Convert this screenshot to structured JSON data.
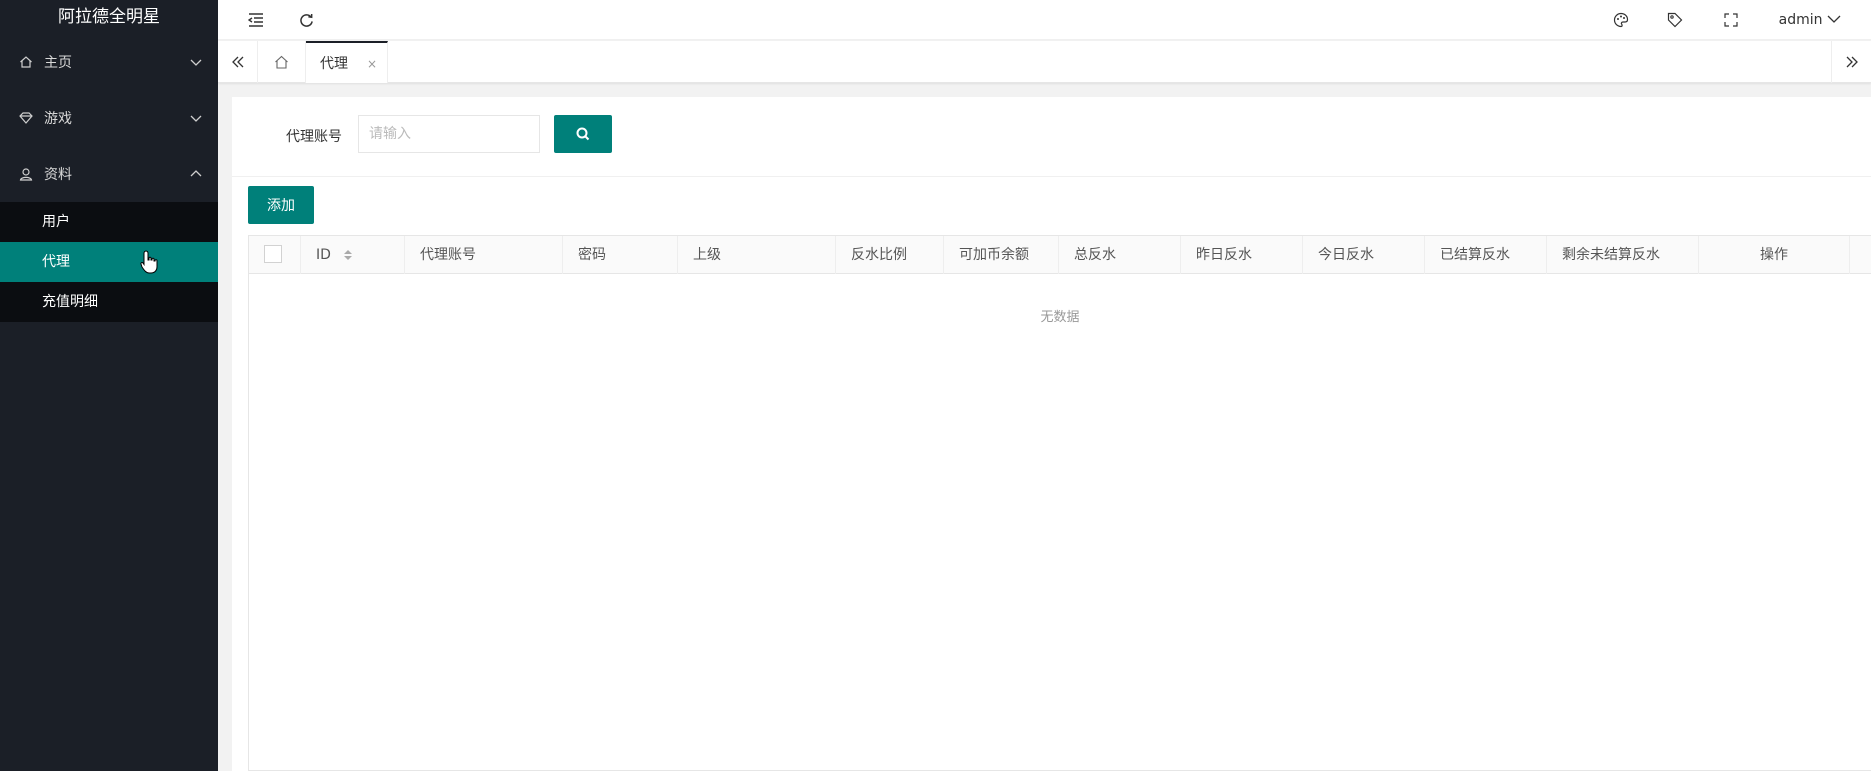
{
  "app": {
    "title": "阿拉德全明星"
  },
  "sidebar": {
    "items": [
      {
        "label": "主页",
        "icon": "home-icon",
        "expanded": false
      },
      {
        "label": "游戏",
        "icon": "diamond-icon",
        "expanded": false
      },
      {
        "label": "资料",
        "icon": "user-icon",
        "expanded": true
      }
    ],
    "subitems": [
      {
        "label": "用户",
        "active": false
      },
      {
        "label": "代理",
        "active": true
      },
      {
        "label": "充值明细",
        "active": false
      }
    ]
  },
  "header": {
    "user": "admin"
  },
  "tabs": {
    "active_label": "代理",
    "close": "×"
  },
  "search": {
    "label": "代理账号",
    "placeholder": "请输入"
  },
  "toolbar": {
    "add_label": "添加"
  },
  "table": {
    "columns": [
      "ID",
      "代理账号",
      "密码",
      "上级",
      "反水比例",
      "可加币余额",
      "总反水",
      "昨日反水",
      "今日反水",
      "已结算反水",
      "剩余未结算反水",
      "操作"
    ],
    "rows": [],
    "empty_text": "无数据"
  },
  "colors": {
    "accent": "#00807a",
    "sidebar_bg": "#1b1f27",
    "submenu_bg": "#0b0d11"
  }
}
